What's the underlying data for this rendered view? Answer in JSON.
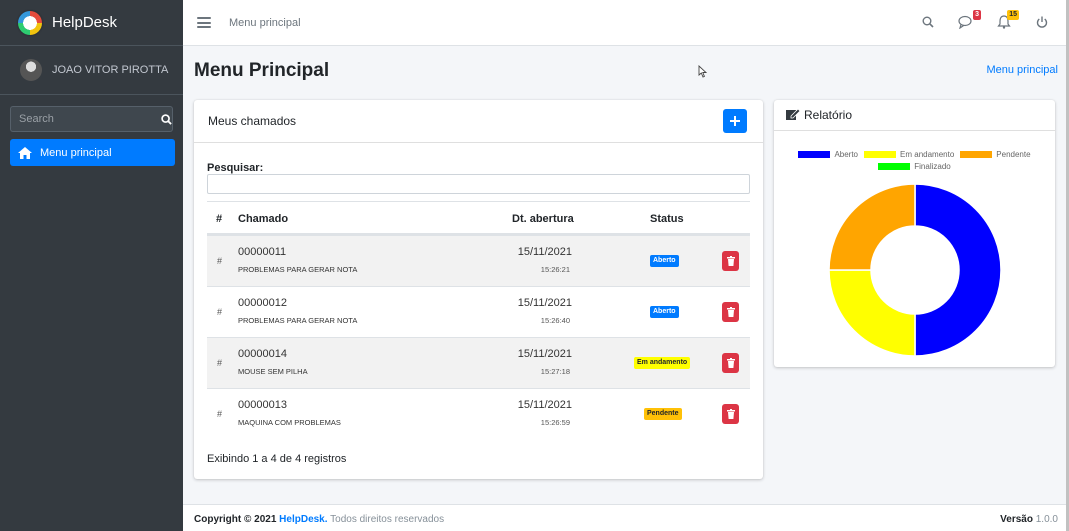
{
  "brand": {
    "name": "HelpDesk"
  },
  "user": {
    "name": "JOAO VITOR PIROTTA"
  },
  "sidebar": {
    "search_placeholder": "Search",
    "items": [
      {
        "label": "Menu principal",
        "icon": "home-icon",
        "active": true
      }
    ]
  },
  "topbar": {
    "link": "Menu principal",
    "messages_badge": "3",
    "notifications_badge": "15"
  },
  "header": {
    "title": "Menu Principal",
    "breadcrumb": "Menu principal"
  },
  "tickets_card": {
    "title": "Meus chamados",
    "search_label": "Pesquisar:",
    "columns": [
      "#",
      "Chamado",
      "Dt. abertura",
      "Status"
    ],
    "rows": [
      {
        "hash": "#",
        "number": "00000011",
        "desc": "PROBLEMAS PARA GERAR NOTA",
        "date": "15/11/2021",
        "time": "15:26:21",
        "status": "Aberto",
        "status_type": "aberto"
      },
      {
        "hash": "#",
        "number": "00000012",
        "desc": "PROBLEMAS PARA GERAR NOTA",
        "date": "15/11/2021",
        "time": "15:26:40",
        "status": "Aberto",
        "status_type": "aberto"
      },
      {
        "hash": "#",
        "number": "00000014",
        "desc": "MOUSE SEM PILHA",
        "date": "15/11/2021",
        "time": "15:27:18",
        "status": "Em andamento",
        "status_type": "andamento"
      },
      {
        "hash": "#",
        "number": "00000013",
        "desc": "MAQUINA COM PROBLEMAS",
        "date": "15/11/2021",
        "time": "15:26:59",
        "status": "Pendente",
        "status_type": "pendente"
      }
    ],
    "info": "Exibindo 1 a 4 de 4 registros"
  },
  "report": {
    "title": "Relatório"
  },
  "chart_data": {
    "type": "pie",
    "donut": true,
    "legend_position": "top",
    "categories": [
      "Aberto",
      "Em andamento",
      "Pendente",
      "Finalizado"
    ],
    "values": [
      2,
      1,
      1,
      0
    ],
    "colors": [
      "#0000ff",
      "#ffff00",
      "#ffa500",
      "#00ff00"
    ]
  },
  "footer": {
    "copyright_prefix": "Copyright © 2021",
    "brand": "HelpDesk.",
    "rights": "Todos direitos reservados",
    "version_label": "Versão",
    "version": "1.0.0"
  },
  "colors": {
    "primary": "#007bff",
    "sidebar": "#343a40",
    "danger": "#dc3545"
  }
}
